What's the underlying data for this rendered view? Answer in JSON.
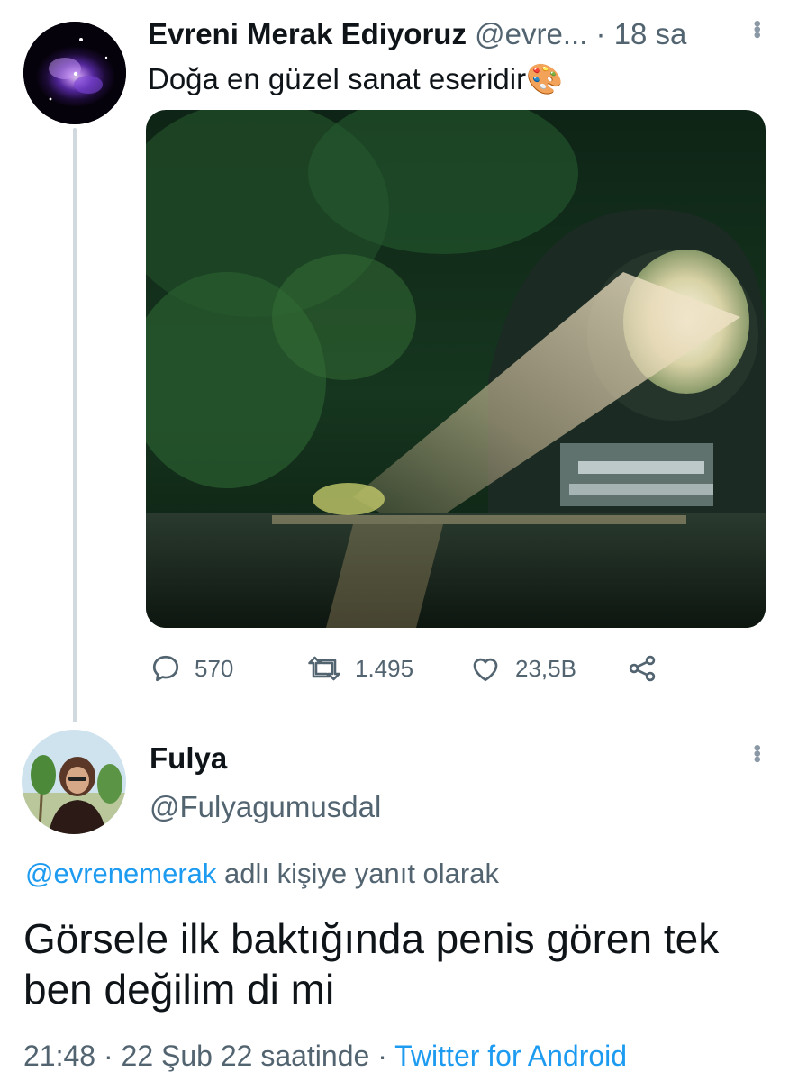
{
  "tweet1": {
    "name": "Evreni Merak Ediyoruz",
    "handle": "@evre...",
    "separator": "·",
    "time": "18 sa",
    "text": "Doğa en güzel sanat eseridir",
    "emoji": "🎨",
    "reply_count": "570",
    "retweet_count": "1.495",
    "like_count": "23,5B"
  },
  "tweet2": {
    "name": "Fulya",
    "handle": "@Fulyagumusdal",
    "reply_mention": "@evrenemerak",
    "reply_suffix": "adlı kişiye yanıt olarak",
    "body": "Görsele ilk baktığında penis gören tek ben değilim di mi",
    "time": "21:48",
    "separator": "·",
    "date": "22 Şub 22 saatinde",
    "source": "Twitter for Android"
  },
  "colors": {
    "link": "#1d9bf0",
    "secondary": "#536471",
    "thread_line": "#cfd9de"
  },
  "icons": [
    "reply-icon",
    "retweet-icon",
    "like-icon",
    "share-icon",
    "more-options-icon"
  ]
}
